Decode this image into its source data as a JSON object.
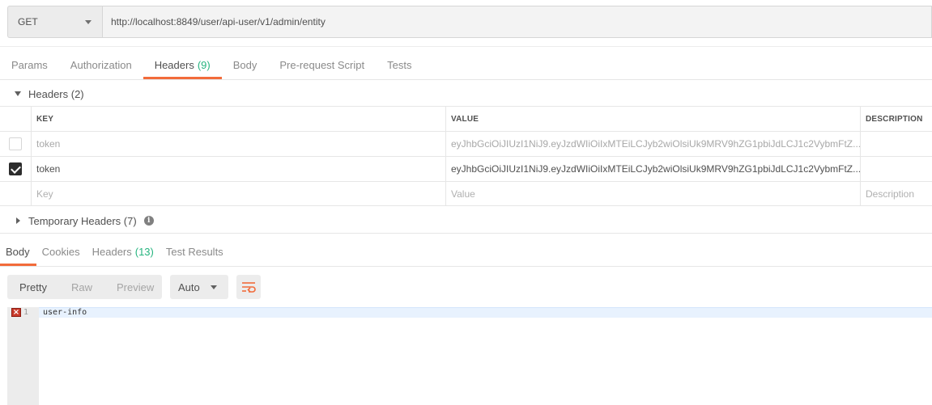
{
  "request": {
    "method": "GET",
    "url": "http://localhost:8849/user/api-user/v1/admin/entity"
  },
  "request_tabs": [
    {
      "label": "Params",
      "count": ""
    },
    {
      "label": "Authorization",
      "count": ""
    },
    {
      "label": "Headers",
      "count": "(9)"
    },
    {
      "label": "Body",
      "count": ""
    },
    {
      "label": "Pre-request Script",
      "count": ""
    },
    {
      "label": "Tests",
      "count": ""
    }
  ],
  "headers_section": {
    "title": "Headers (2)",
    "columns": {
      "key": "KEY",
      "value": "VALUE",
      "description": "DESCRIPTION"
    },
    "rows": [
      {
        "checked": false,
        "key": "token",
        "value": "eyJhbGciOiJIUzI1NiJ9.eyJzdWIiOiIxMTEiLCJyb2wiOlsiUk9MRV9hZG1pbiJdLCJ1c2VybmFtZ...",
        "description": ""
      },
      {
        "checked": true,
        "key": "token",
        "value": "eyJhbGciOiJIUzI1NiJ9.eyJzdWIiOiIxMTEiLCJyb2wiOlsiUk9MRV9hZG1pbiJdLCJ1c2VybmFtZ...",
        "description": ""
      }
    ],
    "placeholders": {
      "key": "Key",
      "value": "Value",
      "description": "Description"
    }
  },
  "temporary_headers": {
    "title": "Temporary Headers (7)"
  },
  "response_tabs": [
    {
      "label": "Body",
      "count": ""
    },
    {
      "label": "Cookies",
      "count": ""
    },
    {
      "label": "Headers",
      "count": "(13)"
    },
    {
      "label": "Test Results",
      "count": ""
    }
  ],
  "response_toolbar": {
    "views": [
      "Pretty",
      "Raw",
      "Preview"
    ],
    "format": "Auto"
  },
  "editor": {
    "line_number": "1",
    "code": "user-info"
  },
  "colors": {
    "accent": "#f26b3a",
    "count_green": "#26b47f",
    "error_red": "#c83a2a"
  }
}
